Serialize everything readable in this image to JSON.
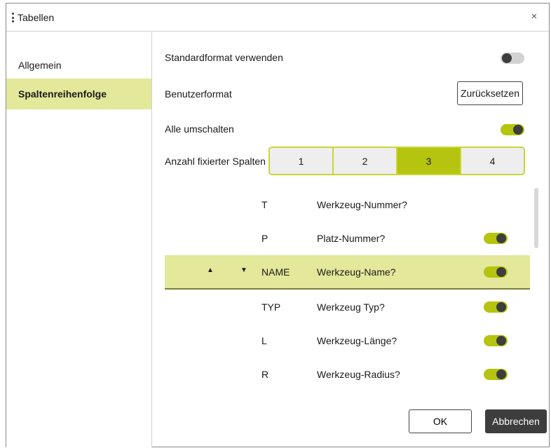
{
  "dialog": {
    "title": "Tabellen",
    "close_icon": "×"
  },
  "sidebar": {
    "items": [
      {
        "label": "Allgemein",
        "active": false
      },
      {
        "label": "Spaltenreihenfolge",
        "active": true
      }
    ]
  },
  "settings": {
    "standard_format": {
      "label": "Standardformat verwenden",
      "enabled": false
    },
    "user_format": {
      "label": "Benutzerformat",
      "reset_label": "Zurücksetzen"
    },
    "toggle_all": {
      "label": "Alle umschalten",
      "enabled": true
    },
    "fixed_columns": {
      "label": "Anzahl fixierter Spalten",
      "options": [
        "1",
        "2",
        "3",
        "4"
      ],
      "selected": "3"
    }
  },
  "columns": {
    "rows": [
      {
        "code": "T",
        "description": "Werkzeug-Nummer?",
        "has_toggle": false,
        "selected": false
      },
      {
        "code": "P",
        "description": "Platz-Nummer?",
        "has_toggle": true,
        "enabled": true,
        "selected": false
      },
      {
        "code": "NAME",
        "description": "Werkzeug-Name?",
        "has_toggle": true,
        "enabled": true,
        "selected": true
      },
      {
        "code": "TYP",
        "description": "Werkzeug Typ?",
        "has_toggle": true,
        "enabled": true,
        "selected": false
      },
      {
        "code": "L",
        "description": "Werkzeug-Länge?",
        "has_toggle": true,
        "enabled": true,
        "selected": false
      },
      {
        "code": "R",
        "description": "Werkzeug-Radius?",
        "has_toggle": true,
        "enabled": true,
        "selected": false
      }
    ],
    "move_up_icon": "▲",
    "move_down_icon": "▼"
  },
  "footer": {
    "ok_label": "OK",
    "cancel_label": "Abbrechen"
  },
  "colors": {
    "accent": "#b5c40e",
    "selected_row": "#e3e89a",
    "dark": "#3d3d3d"
  }
}
